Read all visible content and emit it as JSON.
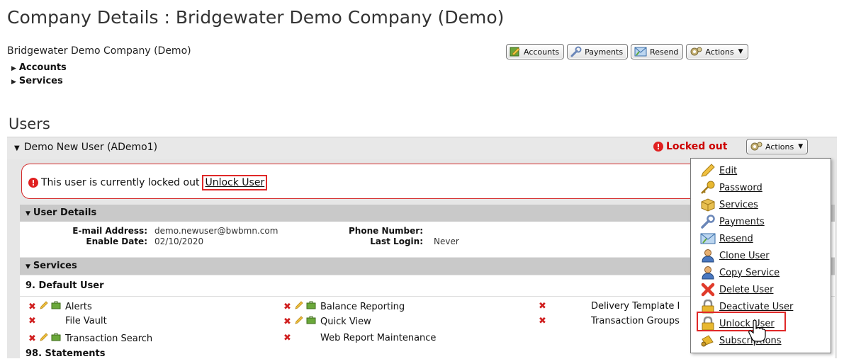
{
  "page_title": "Company Details : Bridgewater Demo Company (Demo)",
  "company_name": "Bridgewater Demo Company (Demo)",
  "tree": [
    {
      "label": "Accounts"
    },
    {
      "label": "Services"
    }
  ],
  "toolbar": {
    "accounts": "Accounts",
    "payments": "Payments",
    "resend": "Resend",
    "actions": "Actions"
  },
  "users_heading": "Users",
  "user": {
    "title": "Demo New User (ADemo1)",
    "status": "Locked out",
    "actions": "Actions",
    "lock_notice": "This user is currently locked out",
    "unlock_link": "Unlock User"
  },
  "user_details": {
    "heading": "User Details",
    "email_label": "E-mail Address:",
    "email_value": "demo.newuser@bwbmn.com",
    "enable_label": "Enable Date:",
    "enable_value": "02/10/2020",
    "phone_label": "Phone Number:",
    "phone_value": "",
    "login_label": "Last Login:",
    "login_value": "Never"
  },
  "services": {
    "heading": "Services",
    "group1": "9. Default User",
    "group2": "98. Statements",
    "col1": [
      "Alerts",
      "File Vault",
      "Transaction Search"
    ],
    "col2": [
      "Balance Reporting",
      "Quick View",
      "Web Report Maintenance"
    ],
    "col3": [
      "Delivery Template I",
      "Transaction Groups"
    ]
  },
  "menu": {
    "items": [
      "Edit",
      "Password",
      "Services",
      "Payments",
      "Resend",
      "Clone User",
      "Copy Service",
      "Delete User",
      "Deactivate User",
      "Unlock User",
      "Subscriptions"
    ]
  },
  "colors": {
    "alert_red": "#cc0000",
    "highlight_red": "#e02828",
    "panel_gray": "#e6e6e6",
    "section_gray": "#c9c9c9"
  }
}
